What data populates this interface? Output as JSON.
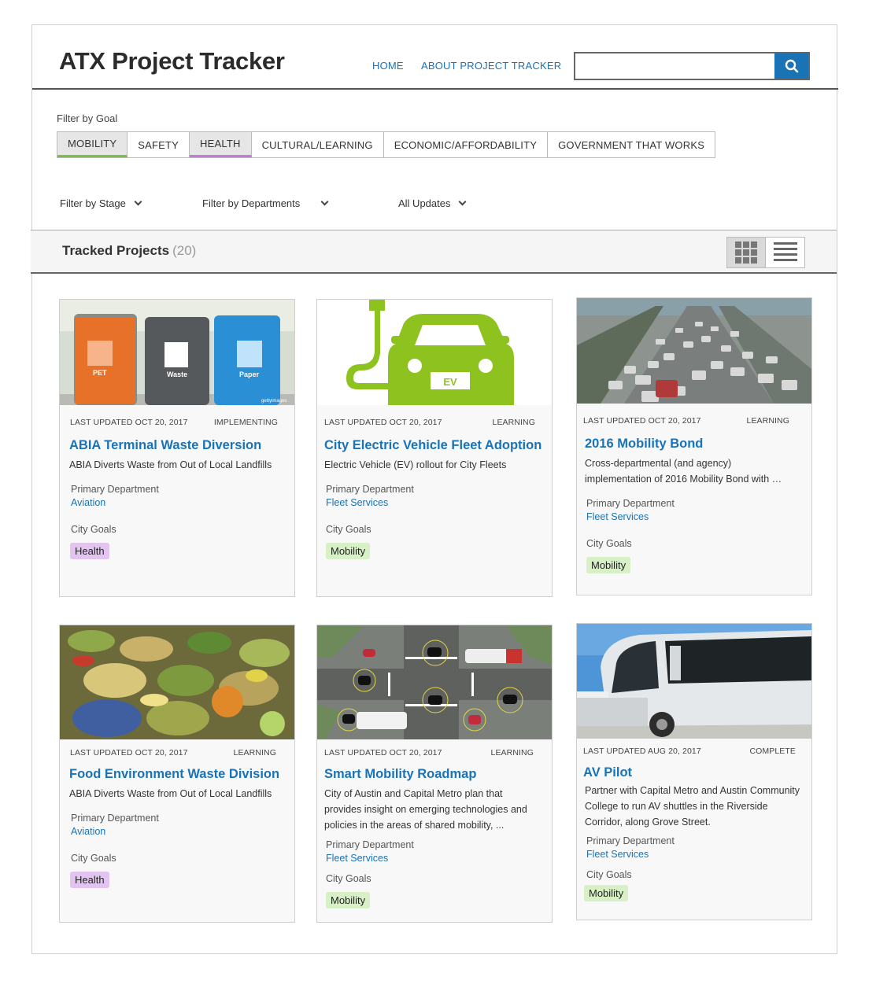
{
  "header": {
    "title": "ATX Project Tracker",
    "nav": [
      "HOME",
      "ABOUT PROJECT TRACKER"
    ],
    "search_value": "",
    "search_icon": "search-icon"
  },
  "filters": {
    "goal_label": "Filter by Goal",
    "goal_tabs": [
      "MOBILITY",
      "SAFETY",
      "HEALTH",
      "CULTURAL/LEARNING",
      "ECONOMIC/AFFORDABILITY",
      "GOVERNMENT THAT WORKS"
    ],
    "selected_goals": [
      "MOBILITY",
      "HEALTH"
    ],
    "stage": "Filter by Stage",
    "departments": "Filter by Departments",
    "updates": "All Updates"
  },
  "tracked": {
    "title": "Tracked Projects",
    "count": "(20)",
    "view_modes": [
      "grid-view-icon",
      "list-view-icon"
    ],
    "active_view": "grid"
  },
  "colors": {
    "accent": "#1a73b5",
    "mobility": "#7cc043",
    "health": "#c677db"
  },
  "labels": {
    "primary_department": "Primary Department",
    "city_goals": "City Goals"
  },
  "projects": [
    {
      "updated": "LAST UPDATED OCT 20, 2017",
      "stage": "IMPLEMENTING",
      "title": "ABIA Terminal Waste Diversion",
      "description": "ABIA Diverts Waste from Out of Local Landfills",
      "department": "Aviation",
      "goal": "Health",
      "bin_labels": [
        "PET",
        "Waste",
        "Paper"
      ],
      "watermark": "gettyimages"
    },
    {
      "updated": "LAST UPDATED OCT 20, 2017",
      "stage": "LEARNING",
      "title": "City Electric Vehicle Fleet Adoption",
      "description": "Electric Vehicle (EV) rollout for City Fleets",
      "department": "Fleet Services",
      "goal": "Mobility",
      "plate": "EV"
    },
    {
      "updated": "LAST UPDATED OCT 20, 2017",
      "stage": "LEARNING",
      "title": "2016 Mobility Bond",
      "description": "Cross-departmental (and agency) implementation of 2016 Mobility Bond with …",
      "department": "Fleet Services",
      "goal": "Mobility"
    },
    {
      "updated": "LAST UPDATED OCT 20, 2017",
      "stage": "LEARNING",
      "title": "Food Environment Waste Division",
      "description": "ABIA Diverts Waste from Out of Local Landfills",
      "department": "Aviation",
      "goal": "Health"
    },
    {
      "updated": "LAST UPDATED OCT 20, 2017",
      "stage": "LEARNING",
      "title": "Smart Mobility Roadmap",
      "description": "City of Austin and Capital Metro plan that provides insight on emerging technologies and policies in the areas of shared mobility, ...",
      "department": "Fleet Services",
      "goal": "Mobility"
    },
    {
      "updated": "LAST UPDATED AUG 20, 2017",
      "stage": "COMPLETE",
      "title": "AV Pilot",
      "description": "Partner with Capital Metro and Austin Community College to run AV shuttles in the Riverside Corridor, along Grove Street.",
      "department": "Fleet Services",
      "goal": "Mobility"
    }
  ]
}
